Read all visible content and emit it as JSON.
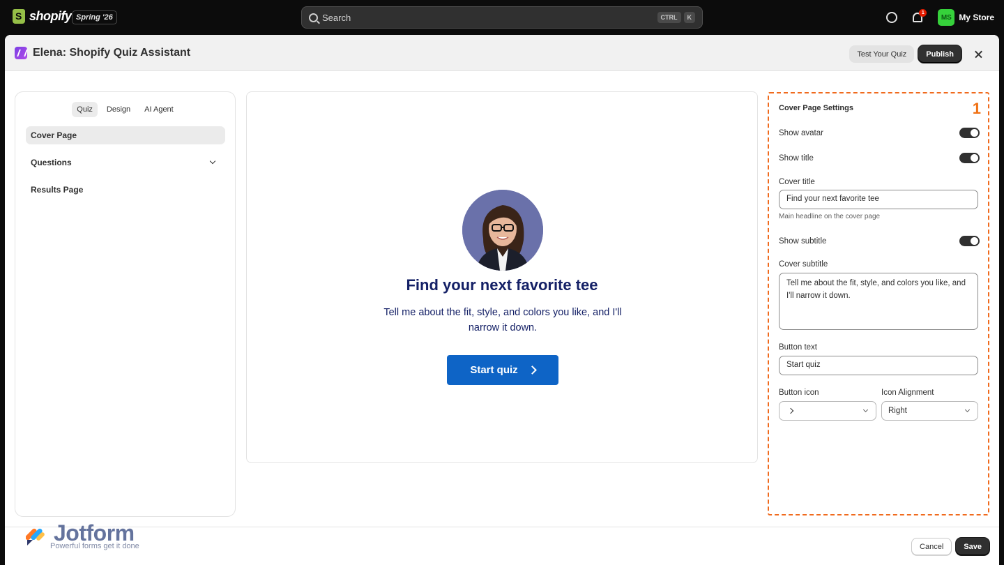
{
  "topbar": {
    "brand": "shopify",
    "edition": "Spring '26",
    "search_placeholder": "Search",
    "shortcut_keys": [
      "CTRL",
      "K"
    ],
    "notification_count": "1",
    "store_initials": "MS",
    "store_name": "My Store"
  },
  "modal": {
    "title": "Elena: Shopify Quiz Assistant",
    "test_button": "Test Your Quiz",
    "publish_button": "Publish"
  },
  "left_panel": {
    "tabs": [
      "Quiz",
      "Design",
      "AI Agent"
    ],
    "active_tab": "Quiz",
    "nav": [
      "Cover Page",
      "Questions",
      "Results Page"
    ],
    "active_nav": "Cover Page"
  },
  "preview": {
    "title": "Find your next favorite tee",
    "subtitle": "Tell me about the fit, style, and colors you like, and I'll narrow it down.",
    "button_text": "Start quiz"
  },
  "settings": {
    "panel_title": "Cover Page Settings",
    "marker": "1",
    "show_avatar_label": "Show avatar",
    "show_avatar": true,
    "show_title_label": "Show title",
    "show_title": true,
    "cover_title_label": "Cover title",
    "cover_title_value": "Find your next favorite tee",
    "cover_title_help": "Main headline on the cover page",
    "show_subtitle_label": "Show subtitle",
    "show_subtitle": true,
    "cover_subtitle_label": "Cover subtitle",
    "cover_subtitle_value": "Tell me about the fit, style, and colors you like, and I'll narrow it down.",
    "button_text_label": "Button text",
    "button_text_value": "Start quiz",
    "button_icon_label": "Button icon",
    "button_icon_value": "chevron-right-icon",
    "icon_alignment_label": "Icon Alignment",
    "icon_alignment_value": "Right"
  },
  "footer": {
    "watermark_name": "Jotform",
    "watermark_tagline": "Powerful forms get it done",
    "cancel_button": "Cancel",
    "save_button": "Save"
  },
  "colors": {
    "accent_dashed": "#f06a1d",
    "start_button": "#0e64c6",
    "preview_text": "#142066",
    "brand_green": "#95bf47"
  }
}
